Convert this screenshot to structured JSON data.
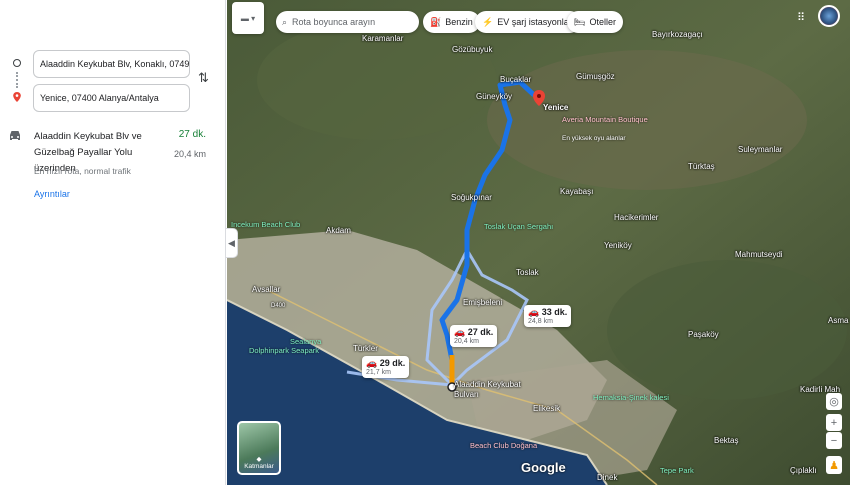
{
  "directions": {
    "origin_value": "Alaaddin Keykubat Blv, Konaklı, 07491 Al",
    "destination_value": "Yenice, 07400 Alanya/Antalya",
    "route_title": "Alaaddin Keykubat Blv ve Güzelbağ Payallar Yolu üzerinden",
    "route_time": "27 dk.",
    "route_distance": "20,4 km",
    "route_desc": "En hızlı rota, normal trafik",
    "details_link": "Ayrıntılar"
  },
  "top_bar": {
    "search_placeholder": "Rota boyunca arayın",
    "chips": [
      "Benzin",
      "EV şarj istasyonları",
      "Oteller"
    ]
  },
  "map": {
    "place_labels": {
      "karamanlar": "Karamanlar",
      "gozubuyuk": "Gözübuyuk",
      "bayirkozagaci": "Bayırkozagaçı",
      "bucaklar": "Buçaklar",
      "gumusgoz": "Gümuşgöz",
      "guneykoy": "Güneyköy",
      "yenice": "Yenice",
      "suleymanlar": "Suleymanlar",
      "turktas": "Türktaş",
      "kayabasi": "Kayabaşı",
      "sogukpinar": "Soğukpınar",
      "hacikerimler": "Hacikerimler",
      "akdam": "Akdam",
      "yenikoy": "Yeniköy",
      "mahmutseydi": "Mahmutseydi",
      "toslak": "Toslak",
      "avsallar": "Avsallar",
      "emisbeleni": "Emişbeleni",
      "asma": "Asma",
      "pasakoy": "Paşaköy",
      "turkler": "Türkler",
      "kadirli": "Kadirli Mah",
      "alaaddin": "Alaaddin Keykubat Bulvarı",
      "elikesik": "Elikesik",
      "bektas": "Bektaş",
      "ciplakli": "Çıplaklı",
      "dinek": "Dinek",
      "road": "D400"
    },
    "poi_labels": {
      "beach_club_west": "Incekum Beach Club",
      "averia": "Averia Mountain Boutique",
      "averia_sub": "En yüksek oyu alanlar",
      "toslak_ucan": "Toslak Uçan Sergahı",
      "sealanya": "Sealanya",
      "dolphinpark": "Dolphinpark Seapark",
      "hemaksia": "Hemaksia-Şinek kalesi",
      "beach_club_dogana": "Beach Club Doğana",
      "tepe_park": "Tepe Park"
    },
    "callouts": [
      {
        "time": "27 dk.",
        "distance": "20,4 km"
      },
      {
        "time": "33 dk.",
        "distance": "24,8 km"
      },
      {
        "time": "29 dk.",
        "distance": "21,7 km"
      }
    ],
    "destination_label": "Yenice",
    "layer_label": "Katmanlar",
    "google": "Google"
  },
  "colors": {
    "route_main": "#1a73e8",
    "route_alt": "#a8c7fa",
    "traffic": "#f29900",
    "time_green": "#188038",
    "link_blue": "#1a73e8",
    "dest_red": "#ea4335"
  },
  "icons": [
    "car-icon",
    "swap-icon",
    "search-icon",
    "fuel-icon",
    "ev-charging-icon",
    "hotel-icon",
    "apps-icon",
    "layers-icon",
    "compass-icon",
    "zoom-in-icon",
    "zoom-out-icon",
    "pegman-icon"
  ]
}
